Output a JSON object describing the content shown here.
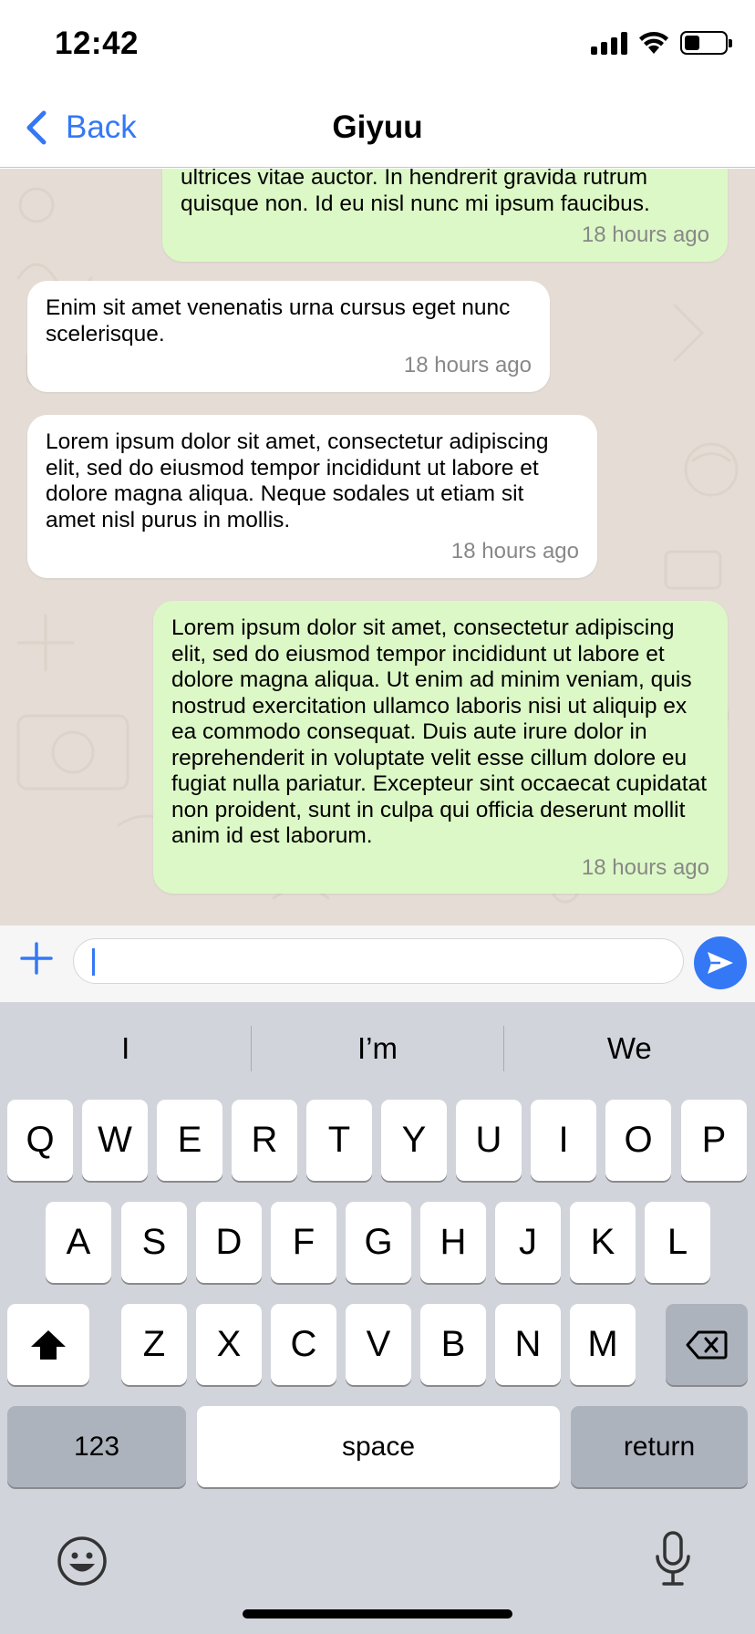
{
  "status_bar": {
    "time": "12:42"
  },
  "nav": {
    "back_label": "Back",
    "title": "Giyuu"
  },
  "messages": [
    {
      "direction": "sent",
      "text": "ultrices vitae auctor. In hendrerit gravida rutrum quisque non. Id eu nisl nunc mi ipsum faucibus.",
      "time": "18 hours ago"
    },
    {
      "direction": "received",
      "text": "Enim sit amet venenatis urna cursus eget nunc scelerisque.",
      "time": "18 hours ago"
    },
    {
      "direction": "received",
      "text": "Lorem ipsum dolor sit amet, consectetur adipiscing elit, sed do eiusmod tempor incididunt ut labore et dolore magna aliqua. Neque sodales ut etiam sit amet nisl purus in mollis.",
      "time": "18 hours ago"
    },
    {
      "direction": "sent",
      "text": "Lorem ipsum dolor sit amet, consectetur adipiscing elit, sed do eiusmod tempor incididunt ut labore et dolore magna aliqua. Ut enim ad minim veniam, quis nostrud exercitation ullamco laboris nisi ut aliquip ex ea commodo consequat. Duis aute irure dolor in reprehenderit in voluptate velit esse cillum dolore eu fugiat nulla pariatur. Excepteur sint occaecat cupidatat non proident, sunt in culpa qui officia deserunt mollit anim id est laborum.",
      "time": "18 hours ago"
    }
  ],
  "composer": {
    "input_value": "",
    "placeholder": ""
  },
  "keyboard": {
    "suggestions": [
      "I",
      "I’m",
      "We"
    ],
    "row1": [
      "Q",
      "W",
      "E",
      "R",
      "T",
      "Y",
      "U",
      "I",
      "O",
      "P"
    ],
    "row2": [
      "A",
      "S",
      "D",
      "F",
      "G",
      "H",
      "J",
      "K",
      "L"
    ],
    "row3": [
      "Z",
      "X",
      "C",
      "V",
      "B",
      "N",
      "M"
    ],
    "numbers_key": "123",
    "space_key": "space",
    "return_key": "return"
  },
  "colors": {
    "accent": "#3478f6",
    "sent_bubble": "#dcf8c6",
    "received_bubble": "#ffffff",
    "chat_background": "#e5ddd5",
    "keyboard_background": "#d1d4db"
  }
}
